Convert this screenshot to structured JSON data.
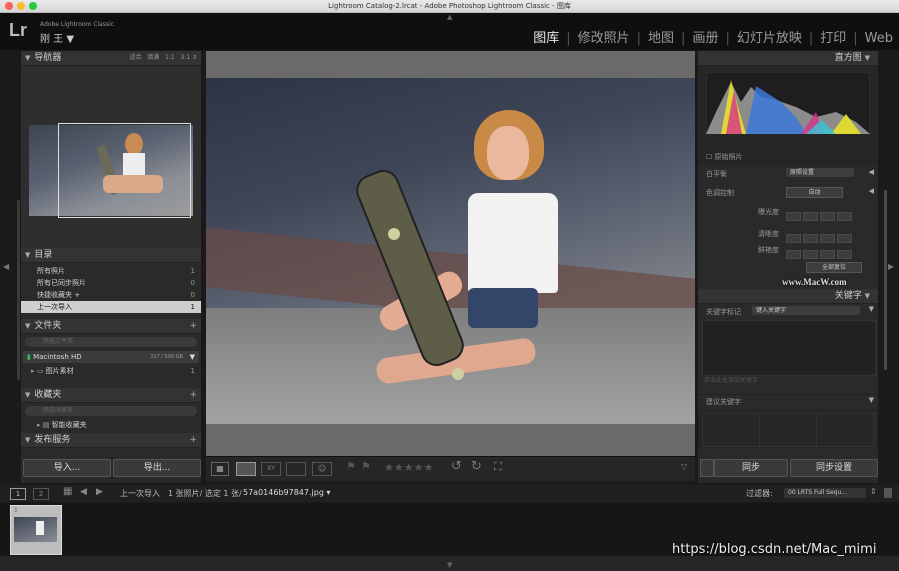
{
  "window": {
    "title": "Lightroom Catalog-2.lrcat - Adobe Photoshop Lightroom Classic - 图库"
  },
  "header": {
    "logo": "Lr",
    "app_name": "Adobe Lightroom Classic",
    "user": "刚 王 ▼",
    "modules": [
      "图库",
      "修改照片",
      "地图",
      "画册",
      "幻灯片放映",
      "打印",
      "Web"
    ],
    "active_module": "图库"
  },
  "left": {
    "navigator": {
      "title": "导航器",
      "zoom_options": [
        "适合",
        "填满",
        "1:1",
        "3:1"
      ]
    },
    "catalog": {
      "title": "目录",
      "items": [
        {
          "label": "所有照片",
          "count": "1"
        },
        {
          "label": "所有已同步照片",
          "count": "0"
        },
        {
          "label": "快捷收藏夹 +",
          "count": "0"
        },
        {
          "label": "上一次导入",
          "count": "1"
        }
      ]
    },
    "folders": {
      "title": "文件夹",
      "search_placeholder": "筛选文件夹",
      "volume_label": "Macintosh HD",
      "volume_space": "317 / 500 GB",
      "folder_label": "图片素材",
      "folder_count": "1"
    },
    "collections": {
      "title": "收藏夹",
      "search_placeholder": "筛选收藏夹",
      "smart_label": "智能收藏夹"
    },
    "publish": {
      "title": "发布服务"
    },
    "import_label": "导入...",
    "export_label": "导出..."
  },
  "right": {
    "histogram": {
      "title": "直方图",
      "original_label": "原始照片"
    },
    "quick_develop": {
      "white_balance_label": "白平衡",
      "white_balance_value": "原照设置",
      "tone_label": "色调控制",
      "auto_label": "自动",
      "exposure_label": "曝光度",
      "clarity_label": "清晰度",
      "vibrance_label": "鲜艳度",
      "reset_label": "全部复位"
    },
    "keywording": {
      "title": "关键字",
      "tags_label": "关键字标记",
      "tags_value": "键入关键字",
      "click_placeholder": "单击此处添加关键字",
      "suggest_label": "建议关键字"
    },
    "sync_label": "同步",
    "sync_settings_label": "同步设置"
  },
  "watermark": "www.MacW.com",
  "filmstrip_bar": {
    "screen1": "1",
    "screen2": "2",
    "breadcrumb": "上一次导入",
    "count_text": "1 张照片/ 选定 1 张/",
    "filename": "57a0146b97847.jpg ▾",
    "filter_label": "过滤器:",
    "filter_value": "00 LRTS Full Sequ..."
  },
  "thumbnail_index": "1",
  "blog_watermark": "https://blog.csdn.net/Mac_mimi"
}
